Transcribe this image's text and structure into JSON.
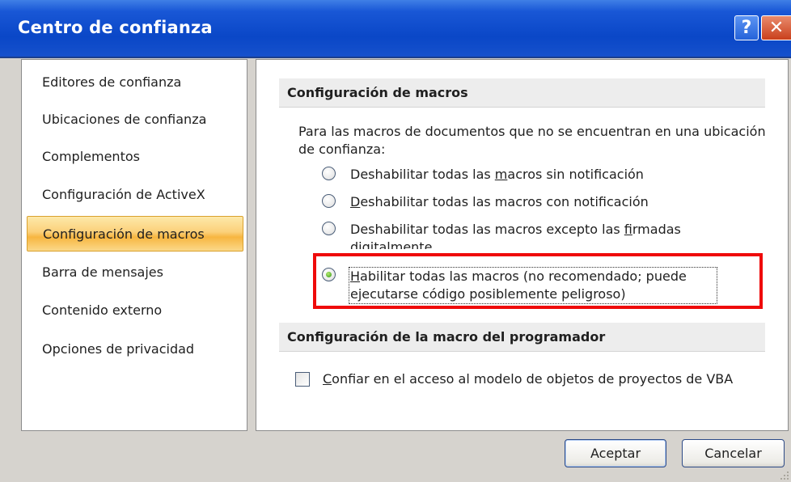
{
  "window": {
    "title": "Centro de confianza"
  },
  "titlebar": {
    "help_label": "?",
    "close_label": "✕"
  },
  "nav": {
    "items": [
      {
        "label": "Editores de confianza",
        "active": false
      },
      {
        "label": "Ubicaciones de confianza",
        "active": false
      },
      {
        "label": "Complementos",
        "active": false
      },
      {
        "label": "Configuración de ActiveX",
        "active": false
      },
      {
        "label": "Configuración de macros",
        "active": true
      },
      {
        "label": "Barra de mensajes",
        "active": false
      },
      {
        "label": "Contenido externo",
        "active": false
      },
      {
        "label": "Opciones de privacidad",
        "active": false
      }
    ]
  },
  "macros": {
    "header": "Configuración de macros",
    "intro": "Para las macros de documentos que no se encuentran en una ubicación de confianza:",
    "options": [
      {
        "before": "Deshabilitar todas las ",
        "accel": "m",
        "after": "acros sin notificación",
        "checked": false
      },
      {
        "before": "",
        "accel": "D",
        "after": "eshabilitar todas las macros con notificación",
        "checked": false
      },
      {
        "before": "Deshabilitar todas las macros excepto las ",
        "accel": "f",
        "after": "irmadas digitalmente",
        "checked": false
      },
      {
        "before": "",
        "accel": "H",
        "after": "abilitar todas las macros (no recomendado; puede ejecutarse código posiblemente peligroso)",
        "checked": true
      }
    ]
  },
  "developer": {
    "header": "Configuración de la macro del programador",
    "checkbox": {
      "before": "",
      "accel": "C",
      "after": "onfiar en el acceso al modelo de objetos de proyectos de VBA",
      "checked": false
    }
  },
  "buttons": {
    "ok": "Aceptar",
    "cancel": "Cancelar"
  },
  "colors": {
    "titlebar": "#0a47c7",
    "selected_nav": "#f7b640",
    "highlight": "#ef0a0a"
  }
}
